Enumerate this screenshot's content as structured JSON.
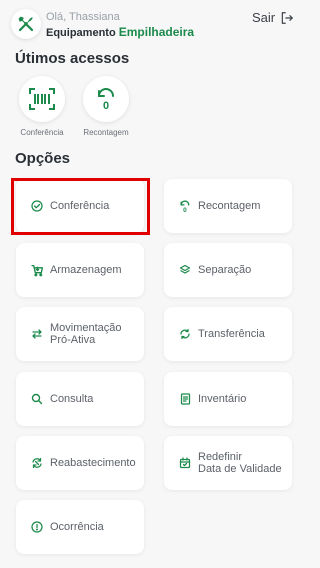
{
  "header": {
    "greeting": "Olá, Thassiana",
    "equipment_label": "Equipamento",
    "equipment_value": "Empilhadeira",
    "logout_label": "Sair",
    "avatar_icon": "tools-icon",
    "logout_icon": "logout-icon"
  },
  "recent": {
    "title": "Útimos acessos",
    "items": [
      {
        "label": "Conferência",
        "icon": "barcode-scan-icon"
      },
      {
        "label": "Recontagem",
        "icon": "recount-icon"
      }
    ]
  },
  "options": {
    "title": "Opções",
    "items": [
      {
        "label": "Conferência",
        "icon": "check-circle-icon"
      },
      {
        "label": "Recontagem",
        "icon": "recount-icon"
      },
      {
        "label": "Armazenagem",
        "icon": "cart-icon"
      },
      {
        "label": "Separação",
        "icon": "layers-icon"
      },
      {
        "label": "Movimentação\nPró-Ativa",
        "icon": "swap-arrows-icon"
      },
      {
        "label": "Transferência",
        "icon": "transfer-icon"
      },
      {
        "label": "Consulta",
        "icon": "search-icon"
      },
      {
        "label": "Inventário",
        "icon": "document-icon"
      },
      {
        "label": "Reabastecimento",
        "icon": "refill-icon"
      },
      {
        "label": "Redefinir\nData de Validade",
        "icon": "calendar-icon"
      },
      {
        "label": "Ocorrência",
        "icon": "alert-icon"
      }
    ]
  },
  "colors": {
    "accent": "#1b8a4b",
    "highlight": "#e00000",
    "background": "#f7f7f8"
  }
}
